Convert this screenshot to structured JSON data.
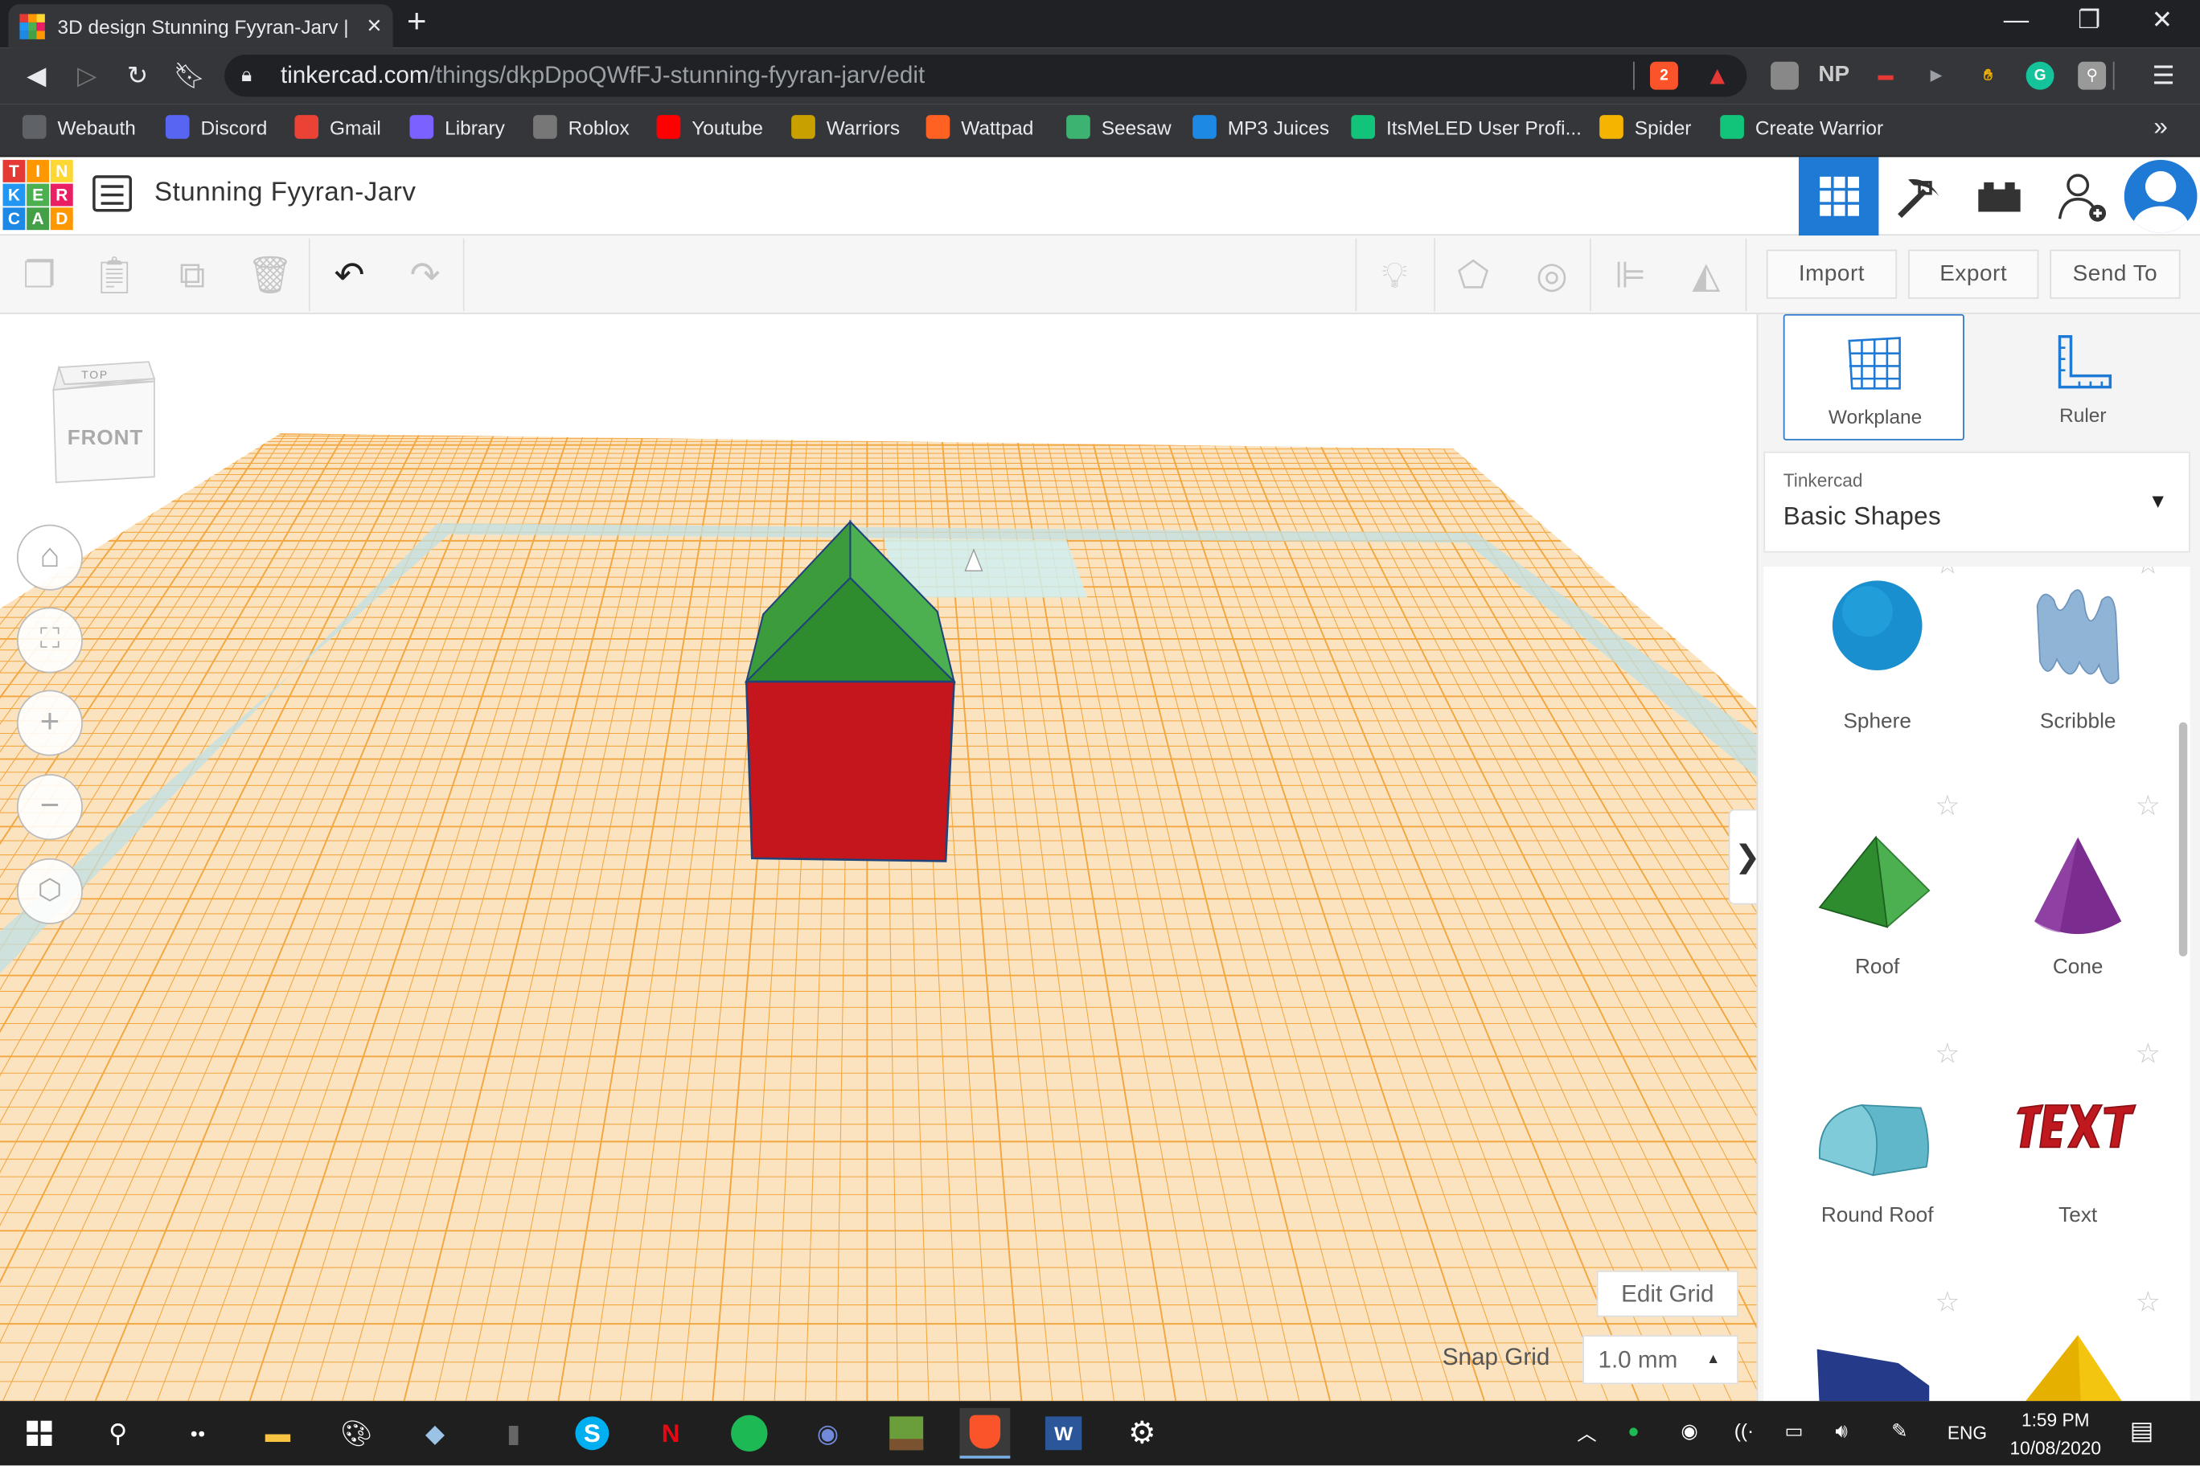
{
  "browser": {
    "tab_title": "3D design Stunning Fyyran-Jarv | T",
    "tab_close": "×",
    "new_tab": "+",
    "url_host": "tinkercad.com",
    "url_path": "/things/dkpDpoQWfFJ-stunning-fyyran-jarv/edit",
    "brave_badge": "2",
    "ext_labels": [
      "NP"
    ],
    "bookmarks": [
      {
        "label": "Webauth",
        "icon": "globe-icon",
        "color": "#5f6368"
      },
      {
        "label": "Discord",
        "icon": "discord-icon",
        "color": "#5865f2"
      },
      {
        "label": "Gmail",
        "icon": "gmail-icon",
        "color": "#ea4335"
      },
      {
        "label": "Library",
        "icon": "library-icon",
        "color": "#7b61ff"
      },
      {
        "label": "Roblox",
        "icon": "roblox-icon",
        "color": "#777777"
      },
      {
        "label": "Youtube",
        "icon": "youtube-icon",
        "color": "#ff0000"
      },
      {
        "label": "Warriors",
        "icon": "warriors-icon",
        "color": "#c8a100"
      },
      {
        "label": "Wattpad",
        "icon": "wattpad-icon",
        "color": "#ff6122"
      },
      {
        "label": "Seesaw",
        "icon": "seesaw-icon",
        "color": "#3cb371"
      },
      {
        "label": "MP3 Juices",
        "icon": "download-icon",
        "color": "#1e88e5"
      },
      {
        "label": "ItsMeLED User Profi...",
        "icon": "ao3-icon",
        "color": "#12c47a"
      },
      {
        "label": "Spider",
        "icon": "spider-icon",
        "color": "#f4b400"
      },
      {
        "label": "Create Warrior",
        "icon": "create-warrior-icon",
        "color": "#12c47a"
      }
    ],
    "bookmarks_more": "»"
  },
  "app": {
    "logo_letters": [
      "T",
      "I",
      "N",
      "K",
      "E",
      "R",
      "C",
      "A",
      "D"
    ],
    "logo_colors": [
      "#e53935",
      "#ff9800",
      "#fdd835",
      "#2196f3",
      "#4caf50",
      "#e91e63",
      "#1e88e5",
      "#43a047",
      "#ff9800"
    ],
    "design_title": "Stunning Fyyran-Jarv",
    "accent": "#1f7ad6"
  },
  "toolbar": {
    "import": "Import",
    "export": "Export",
    "send_to": "Send To"
  },
  "workspace": {
    "viewcube_top": "TOP",
    "viewcube_front": "FRONT",
    "edit_grid": "Edit Grid",
    "snap_grid_label": "Snap Grid",
    "snap_grid_value": "1.0 mm",
    "expand_panel": "❯"
  },
  "panel": {
    "workplane": "Workplane",
    "ruler": "Ruler",
    "library_source": "Tinkercad",
    "library_name": "Basic Shapes",
    "shapes": [
      {
        "label": "Sphere",
        "color": "#1a8fcf"
      },
      {
        "label": "Scribble",
        "color": "#8fb4d6"
      },
      {
        "label": "Roof",
        "color": "#3a9e3a"
      },
      {
        "label": "Cone",
        "color": "#7b2c8f"
      },
      {
        "label": "Round Roof",
        "color": "#5fb7c9"
      },
      {
        "label": "Text",
        "color": "#c0181f"
      }
    ]
  },
  "scene": {
    "box_color": "#c4161c",
    "roof_color": "#3a9e3a",
    "grid_color": "#f4a234"
  },
  "taskbar": {
    "tray_lang": "ENG",
    "time": "1:59 PM",
    "date": "10/08/2020"
  }
}
